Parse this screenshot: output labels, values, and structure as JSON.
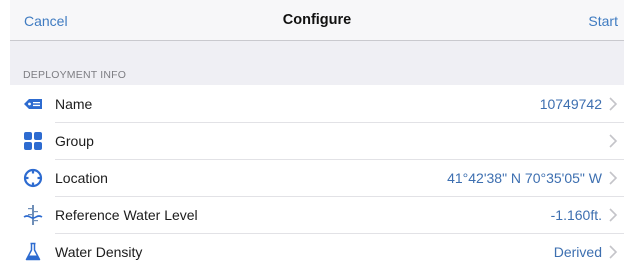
{
  "nav": {
    "cancel": "Cancel",
    "title": "Configure",
    "start": "Start"
  },
  "section": {
    "title": "DEPLOYMENT INFO"
  },
  "rows": [
    {
      "label": "Name",
      "value": "10749742",
      "icon": "tag-icon"
    },
    {
      "label": "Group",
      "value": "",
      "icon": "group-grid-icon"
    },
    {
      "label": "Location",
      "value": "41°42'38\" N 70°35'05\" W",
      "icon": "location-crosshair-icon"
    },
    {
      "label": "Reference Water Level",
      "value": "-1.160ft.",
      "icon": "water-level-gauge-icon"
    },
    {
      "label": "Water Density",
      "value": "Derived",
      "icon": "flask-icon"
    }
  ],
  "colors": {
    "accent": "#3f7bc1",
    "value_text": "#3d6fb0",
    "icon_blue": "#2d6bd0"
  }
}
